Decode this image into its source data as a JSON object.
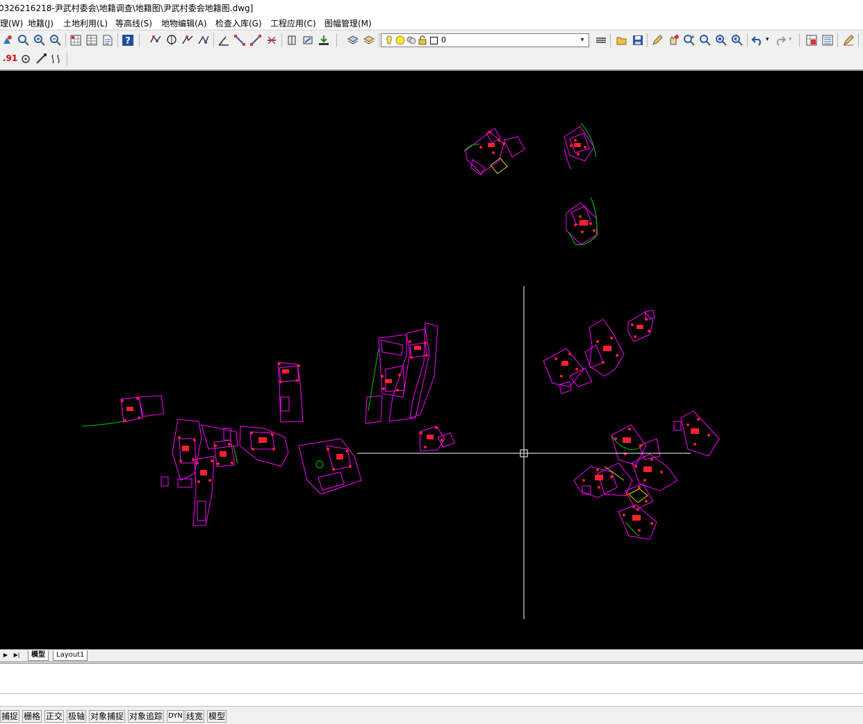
{
  "window": {
    "title": "0326216218-尹武村委会\\地籍调查\\地籍图\\尹武村委会地籍图.dwg]"
  },
  "menu": [
    "理(W)",
    "地籍(J)",
    "土地利用(L)",
    "等高线(S)",
    "地物编辑(A)",
    "检查入库(G)",
    "工程应用(C)",
    "图幅管理(M)"
  ],
  "layer_control": {
    "value": "0"
  },
  "toolbar2": {
    "value_label": ".91"
  },
  "layout_tabs": [
    "模型",
    "Layout1"
  ],
  "status_buttons": [
    "捕捉",
    "栅格",
    "正交",
    "极轴",
    "对象捕捉",
    "对象追踪",
    "DYN",
    "线宽",
    "模型"
  ],
  "colors": {
    "canvas_bg": "#000000",
    "parcel": "#ff00ff",
    "vertex": "#ff2020",
    "road": "#00cc00",
    "crosshair": "#ffffff"
  }
}
